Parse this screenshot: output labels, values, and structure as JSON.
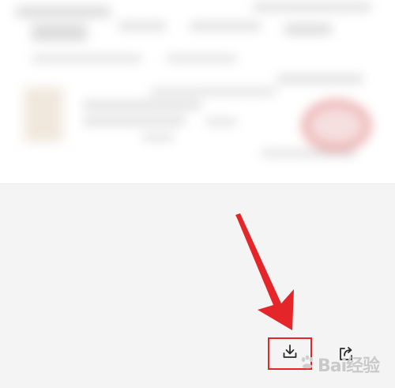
{
  "page": {
    "accent_color": "#e4262a",
    "background_color": "#f4f4f4"
  },
  "toolbar": {
    "download_icon": "download-icon",
    "share_icon": "share-icon"
  },
  "watermark": {
    "brand_icon": "paw-logo-icon",
    "text": "Bai经验"
  }
}
